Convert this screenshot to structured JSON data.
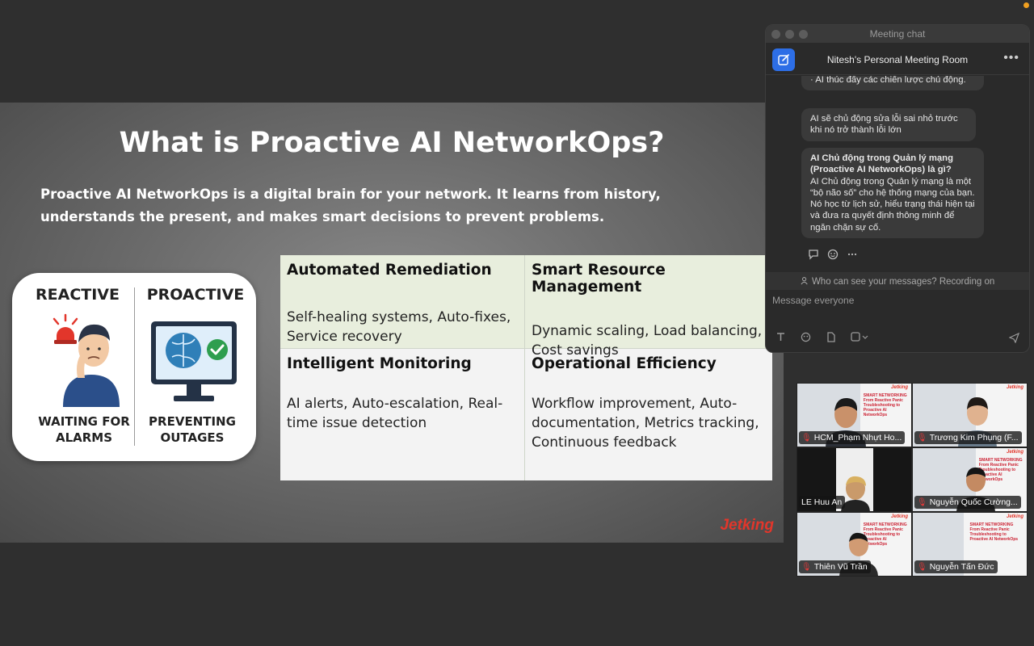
{
  "slide": {
    "title": "What is Proactive AI NetworkOps?",
    "intro": "Proactive AI NetworkOps is a digital brain for your network. It learns from history, understands the present, and makes smart decisions to prevent problems.",
    "card": {
      "left_heading": "REACTIVE",
      "right_heading": "PROACTIVE",
      "left_caption": "WAITING FOR ALARMS",
      "right_caption": "PREVENTING OUTAGES"
    },
    "table": [
      {
        "title": "Automated Remediation",
        "body": "Self-healing systems, Auto-fixes, Service recovery"
      },
      {
        "title": "Smart Resource Management",
        "body": "Dynamic scaling, Load balancing, Cost savings"
      },
      {
        "title": "Intelligent Monitoring",
        "body": "AI alerts, Auto-escalation, Real-time issue detection"
      },
      {
        "title": "Operational Efficiency",
        "body": "Workflow improvement, Auto-documentation, Metrics tracking, Continuous feedback"
      }
    ],
    "brand": "Jetking"
  },
  "chat": {
    "window_title": "Meeting chat",
    "room_name": "Nitesh's Personal Meeting Room",
    "more_label": "•••",
    "messages": {
      "m1": "·        AI thúc đẩy các chiến lược chủ động.",
      "m2": "AI sẽ chủ động sửa lỗi sai nhỏ trước khi nó trở thành lỗi lớn",
      "m3_bold": "AI Chủ động trong Quản lý mạng (Proactive AI NetworkOps) là gì?",
      "m3_body": "AI Chủ động trong Quản lý mạng là một “bộ não số” cho hệ thống mạng của bạn. Nó học từ lịch sử, hiểu trạng thái hiện tại và đưa ra quyết định thông minh để ngăn chặn sự cố."
    },
    "visibility_notice": "Who can see your messages? Recording on",
    "input_placeholder": "Message everyone"
  },
  "participants": [
    {
      "name": "HCM_Phạm Nhựt Ho..."
    },
    {
      "name": "Trương Kim Phụng (F..."
    },
    {
      "name": "LE Huu An"
    },
    {
      "name": "Nguyễn Quốc Cường..."
    },
    {
      "name": "Thiên Vũ Trần"
    },
    {
      "name": "Nguyễn Tấn Đức"
    }
  ],
  "colors": {
    "accent_blue": "#2d6ee6",
    "brand_red": "#e2362b",
    "muted_mic": "#e03a3a",
    "table_highlight": "#e8eedd"
  },
  "icons": [
    "edit-icon",
    "more-icon",
    "reply-icon",
    "emoji-icon",
    "text-format-icon",
    "file-icon",
    "screenshot-icon",
    "send-icon",
    "mic-muted-icon",
    "people-icon"
  ]
}
